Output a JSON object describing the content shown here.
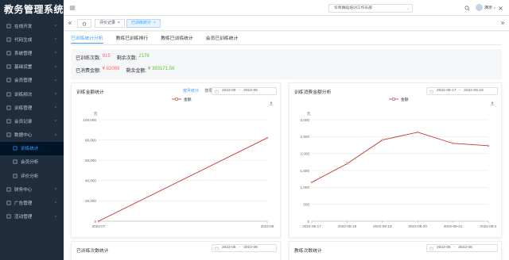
{
  "app": {
    "logo": "教务管理系统"
  },
  "sidebar": {
    "items": [
      {
        "label": "在线开发"
      },
      {
        "label": "代码生成"
      },
      {
        "label": "系统管理"
      },
      {
        "label": "基础设置"
      },
      {
        "label": "会员管理"
      },
      {
        "label": "训练频次"
      },
      {
        "label": "训练管理"
      },
      {
        "label": "会员记录"
      },
      {
        "label": "数据中心"
      }
    ],
    "subitems": [
      {
        "label": "训练统计"
      },
      {
        "label": "会员分析"
      },
      {
        "label": "评价分析"
      }
    ],
    "items_after": [
      {
        "label": "财务中心"
      },
      {
        "label": "广告管理"
      },
      {
        "label": "活动管理"
      }
    ]
  },
  "header": {
    "org": "华青舞蹈培训工作乐部",
    "user": "演示"
  },
  "tabs": [
    {
      "label": "评价记录"
    },
    {
      "label": "已训练统计"
    }
  ],
  "subtabs": [
    {
      "label": "已训练统计分析"
    },
    {
      "label": "教练已训练排行"
    },
    {
      "label": "教练已训练统计"
    },
    {
      "label": "会员已训练统计"
    }
  ],
  "stats": {
    "trained_label": "已训练次数:",
    "trained_value": "915",
    "remaining_label": "剩余次数:",
    "remaining_value": "2176",
    "consumed_label": "已消费金额:",
    "consumed_value": "¥ 82069",
    "balance_label": "剩余金额:",
    "balance_value": "¥ 393171.56"
  },
  "cards": {
    "amount": {
      "title": "训练金额统计",
      "toggle_month": "按月统计",
      "toggle_day": "按周统计",
      "date_start": "2022-06",
      "date_end": "2022-08",
      "sep": "-"
    },
    "consume": {
      "title": "训练消费金额分析",
      "date_start": "2022-08-17",
      "date_end": "2022-08-23",
      "sep": "-"
    },
    "trained_count": {
      "title": "已训练次数统计",
      "date_start": "2022-05",
      "date_end": "2022-08",
      "sep": "-"
    },
    "coach_count": {
      "title": "教练次数统计",
      "date_start": "2022-05",
      "date_end": "2022-08",
      "sep": "-"
    }
  },
  "chart_data": [
    {
      "type": "line",
      "legend": [
        "金额"
      ],
      "ylabel": "元",
      "categories": [
        "2022-07",
        "2022-08"
      ],
      "series": [
        {
          "name": "金额",
          "values": [
            0,
            82069
          ]
        }
      ],
      "yticks": [
        "0",
        "20,000",
        "40,000",
        "60,000",
        "80,000",
        "100,000"
      ],
      "ylim": [
        0,
        100000
      ],
      "color": "#c23531"
    },
    {
      "type": "line",
      "legend": [
        "金额"
      ],
      "ylabel": "元",
      "categories": [
        "2022-08-17",
        "2022-08-18",
        "2022-08-19",
        "2022-08-20",
        "2022-08-21",
        "2022-08-2"
      ],
      "series": [
        {
          "name": "金额",
          "values": [
            1150,
            1700,
            2400,
            2630,
            2300,
            2230
          ]
        }
      ],
      "yticks": [
        "0",
        "500",
        "1,000",
        "1,500",
        "2,000",
        "2,500",
        "3,000"
      ],
      "ylim": [
        0,
        3000
      ],
      "color": "#c23531"
    }
  ],
  "colors": {
    "sidebar_bg": "#1f2d3d",
    "accent": "#409eff",
    "red": "#f56c6c",
    "green": "#67c23a",
    "series": "#c23531"
  }
}
